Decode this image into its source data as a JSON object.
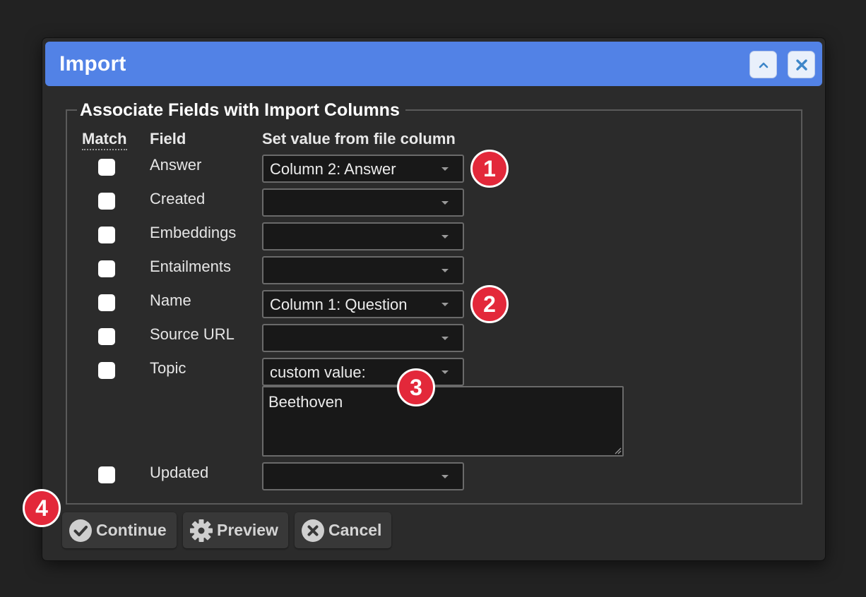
{
  "dialog": {
    "title": "Import"
  },
  "fieldset": {
    "legend": "Associate Fields with Import Columns"
  },
  "headers": {
    "match": "Match",
    "field": "Field",
    "column": "Set value from file column"
  },
  "rows": [
    {
      "field": "Answer",
      "column": "Column 2: Answer",
      "match": false
    },
    {
      "field": "Created",
      "column": "",
      "match": false
    },
    {
      "field": "Embeddings",
      "column": "",
      "match": false
    },
    {
      "field": "Entailments",
      "column": "",
      "match": false
    },
    {
      "field": "Name",
      "column": "Column 1: Question",
      "match": false
    },
    {
      "field": "Source URL",
      "column": "",
      "match": false
    },
    {
      "field": "Topic",
      "column": "custom value:",
      "match": false,
      "custom_value": "Beethoven"
    },
    {
      "field": "Updated",
      "column": "",
      "match": false
    }
  ],
  "callouts": [
    "1",
    "2",
    "3",
    "4"
  ],
  "buttons": {
    "continue": "Continue",
    "preview": "Preview",
    "cancel": "Cancel"
  },
  "colors": {
    "titlebar": "#5282e6",
    "callout": "#e3283a",
    "background": "#222222",
    "dialog": "#2b2b2b"
  },
  "icons": {
    "collapse": "chevron-up-icon",
    "close": "close-icon",
    "continue": "check-circle-icon",
    "preview": "gear-icon",
    "cancel": "x-circle-icon"
  }
}
